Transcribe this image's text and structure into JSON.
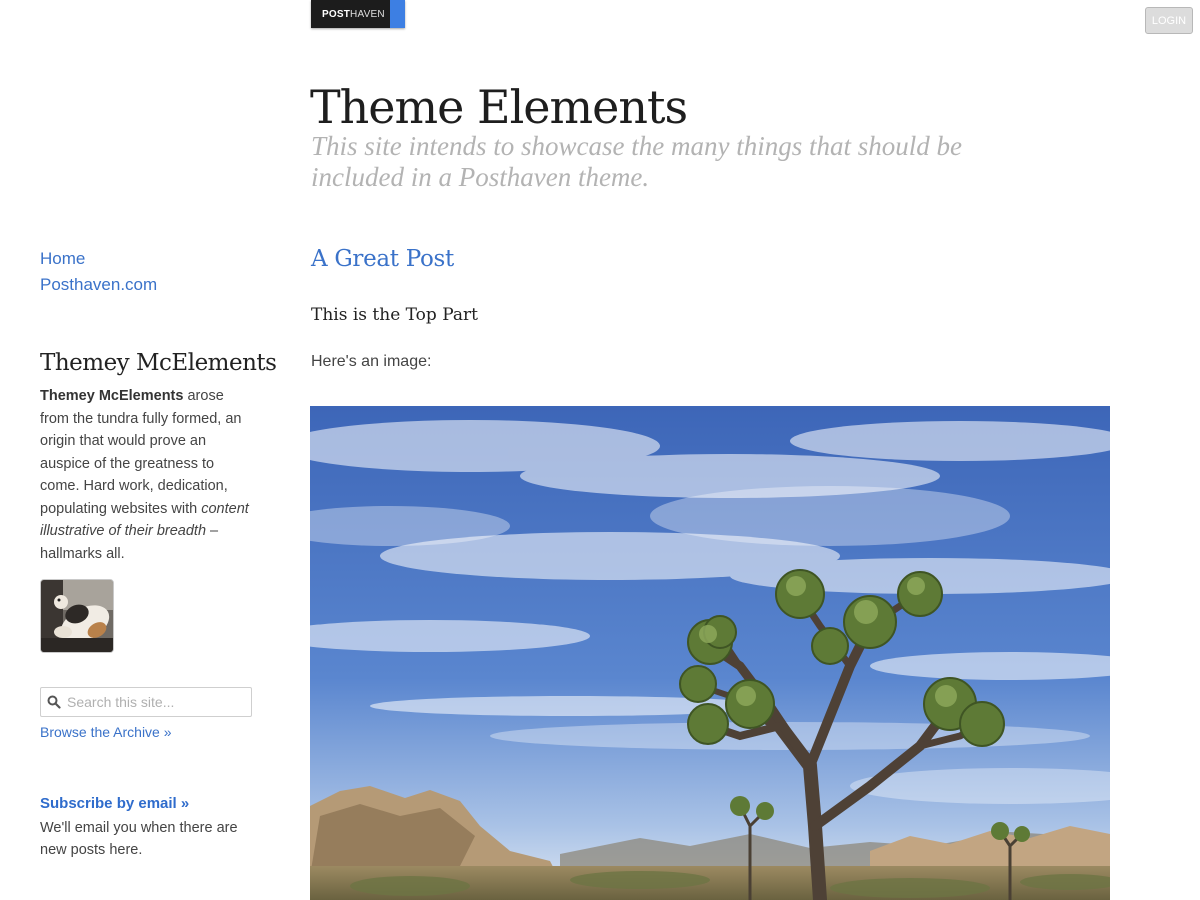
{
  "badge": {
    "strong": "POST",
    "light": "HAVEN"
  },
  "header": {
    "login_label": "LOGIN",
    "title": "Theme Elements",
    "description": "This site intends to showcase the many things that should be included in a Posthaven theme."
  },
  "sidebar": {
    "nav": [
      {
        "label": "Home"
      },
      {
        "label": "Posthaven.com"
      }
    ],
    "author": {
      "name": "Themey McElements",
      "bio_name": "Themey McElements",
      "bio_part1": " arose from the tundra fully formed, an origin that would prove an auspice of the greatness to come. Hard work, dedication, populating websites with ",
      "bio_italic": "content illustrative of their breadth",
      "bio_part2": " – hallmarks all."
    },
    "search": {
      "placeholder": "Search this site..."
    },
    "archive_label": "Browse the Archive »",
    "subscribe_label": "Subscribe by email  »",
    "subscribe_desc": "We'll email you when there are new posts here."
  },
  "post": {
    "title": "A Great Post",
    "subhead": "This is the Top Part",
    "text": "Here's an image:"
  },
  "colors": {
    "link": "#3a72c9",
    "badge_bg": "#1c1c1c",
    "badge_stripe": "#3d7fe3",
    "sky": "#4a72c4"
  },
  "icons": {
    "search": "search-icon"
  }
}
